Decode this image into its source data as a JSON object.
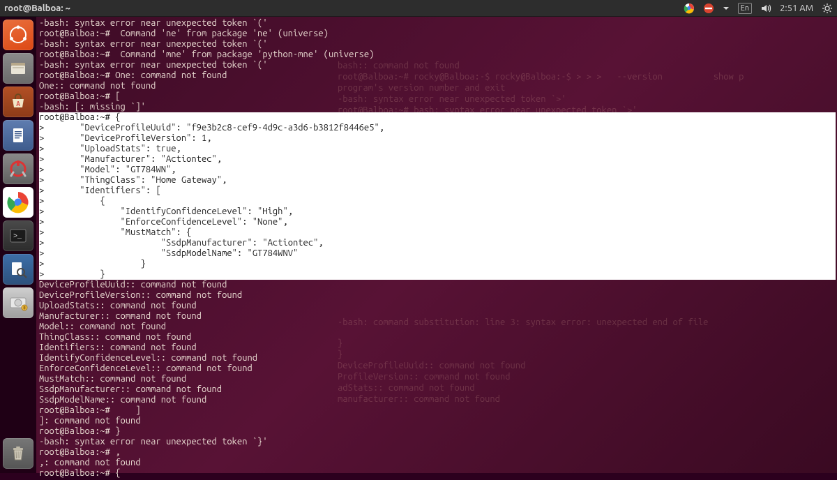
{
  "panel": {
    "title": "root@Balboa: ~",
    "lang": "En",
    "time": "2:51 AM"
  },
  "launcher": {
    "dash": "dash-icon",
    "items": [
      "files-icon",
      "software-center-icon",
      "document-icon",
      "settings-icon",
      "chrome-icon",
      "terminal-icon",
      "search-icon",
      "disks-icon"
    ],
    "trash": "trash-icon"
  },
  "ghost": {
    "block": "bash:: command not found\nroot@Balboa:~# rocky@Balboa:-$ rocky@Balboa:-$ > > >   --version          show p\nprogram's version number and exit\n-bash: syntax error near unexpected token `>'\nroot@Balboa:~# bash: syntax error near unexpected token `>'",
    "mid1": "-bash: command substitution: line 3: syntax error: unexpected end of file",
    "mid2": "}\n}\nDeviceProfileUuid:: command not found\nProfileVersion:: command not found\nadStats:: command not found\nmanufacturer:: command not found"
  },
  "terminal": {
    "lines_top": [
      "-bash: syntax error near unexpected token `('",
      "root@Balboa:~#  Command 'ne' from package 'ne' (universe)",
      "-bash: syntax error near unexpected token `('",
      "root@Balboa:~#  Command 'mne' from package 'python-mne' (universe)",
      "-bash: syntax error near unexpected token `('",
      "root@Balboa:~# One: command not found",
      "One:: command not found",
      "root@Balboa:~# [",
      "-bash: [: missing `]'"
    ],
    "highlight": [
      "root@Balboa:~# {",
      ">       \"DeviceProfileUuid\": \"f9e3b2c8-cef9-4d9c-a3d6-b3812f8446e5\",",
      ">       \"DeviceProfileVersion\": 1,",
      ">       \"UploadStats\": true,",
      ">       \"Manufacturer\": \"Actiontec\",",
      ">       \"Model\": \"GT784WN\",",
      ">       \"ThingClass\": \"Home Gateway\",",
      ">       \"Identifiers\": [",
      ">           {",
      ">               \"IdentifyConfidenceLevel\": \"High\",",
      ">               \"EnforceConfidenceLevel\": \"None\",",
      ">               \"MustMatch\": {",
      ">                       \"SsdpManufacturer\": \"Actiontec\",",
      ">                       \"SsdpModelName\": \"GT784WNV\"",
      ">                   }",
      ">           }"
    ],
    "lines_bottom": [
      "DeviceProfileUuid:: command not found",
      "DeviceProfileVersion:: command not found",
      "UploadStats:: command not found",
      "Manufacturer:: command not found",
      "Model:: command not found",
      "ThingClass:: command not found",
      "Identifiers:: command not found",
      "IdentifyConfidenceLevel:: command not found",
      "EnforceConfidenceLevel:: command not found",
      "MustMatch:: command not found",
      "SsdpManufacturer:: command not found",
      "SsdpModelName:: command not found",
      "root@Balboa:~#     ]",
      "]: command not found",
      "root@Balboa:~# }",
      "-bash: syntax error near unexpected token `}'",
      "root@Balboa:~# ,",
      ",: command not found",
      "root@Balboa:~# {"
    ]
  }
}
